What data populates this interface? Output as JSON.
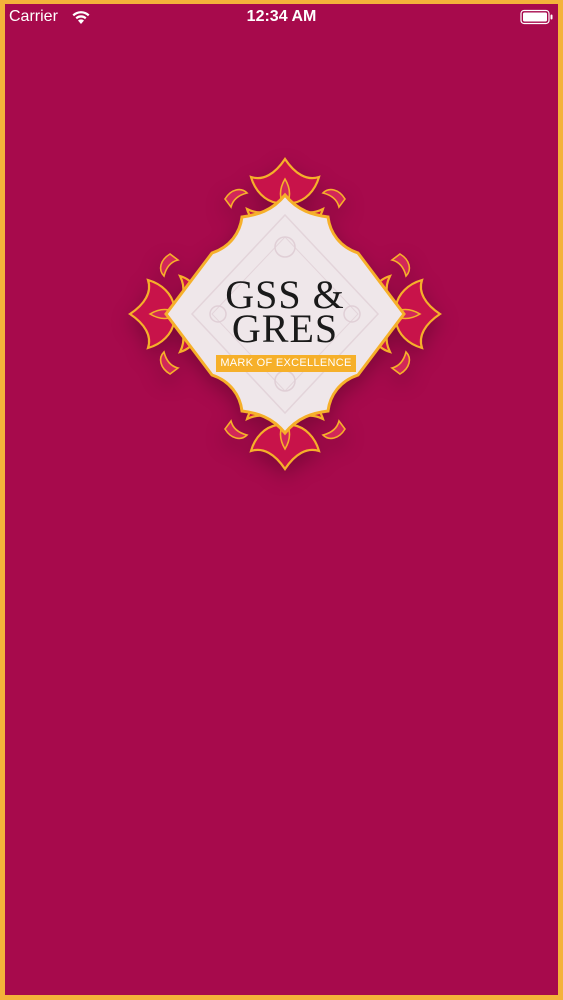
{
  "status_bar": {
    "carrier": "Carrier",
    "time": "12:34 AM"
  },
  "brand": {
    "line1": "GSS &",
    "line2": "GRES",
    "tagline": "MARK OF EXCELLENCE"
  },
  "colors": {
    "background": "#a70a4c",
    "frame": "#f4b23a",
    "ornament_dark": "#c8134a",
    "ornament_light": "#d2275a",
    "gold": "#f6b02a",
    "diamond": "#efe7ea"
  }
}
